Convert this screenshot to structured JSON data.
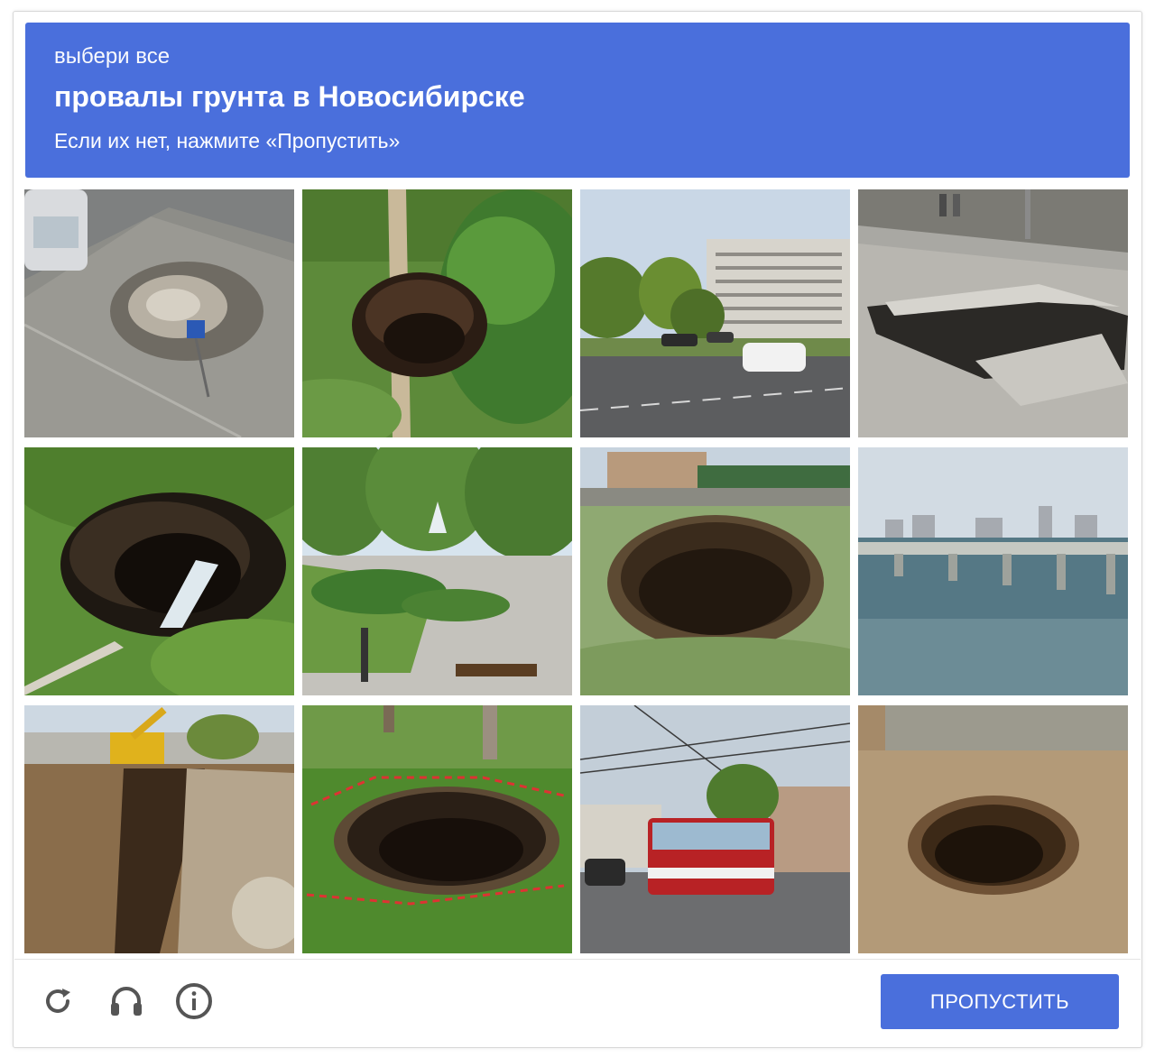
{
  "header": {
    "pre": "выбери все",
    "title": "провалы грунта в Новосибирске",
    "hint": "Если их нет, нажмите «Пропустить»"
  },
  "tiles": [
    {
      "label": "sinkhole on flooded sidewalk next to car and road sign"
    },
    {
      "label": "sinkhole among green bushes on a dirt path"
    },
    {
      "label": "city street with white car and apartment block"
    },
    {
      "label": "collapsed asphalt sinkhole on wet road"
    },
    {
      "label": "sinkhole with broken water pipe in grass"
    },
    {
      "label": "park with fountain and flower beds"
    },
    {
      "label": "round sinkhole in a grassy yard"
    },
    {
      "label": "bridge over river with city skyline"
    },
    {
      "label": "excavation trench with yellow excavator"
    },
    {
      "label": "sinkhole in park fenced with red-white tape"
    },
    {
      "label": "city street with red trolleybus"
    },
    {
      "label": "sinkhole in sandy ground"
    }
  ],
  "footer": {
    "icons": [
      "reload-icon",
      "headphones-icon",
      "info-icon"
    ],
    "skip_label": "ПРОПУСТИТЬ"
  },
  "colors": {
    "accent": "#4a6fdc",
    "border": "#d7d7d7"
  }
}
